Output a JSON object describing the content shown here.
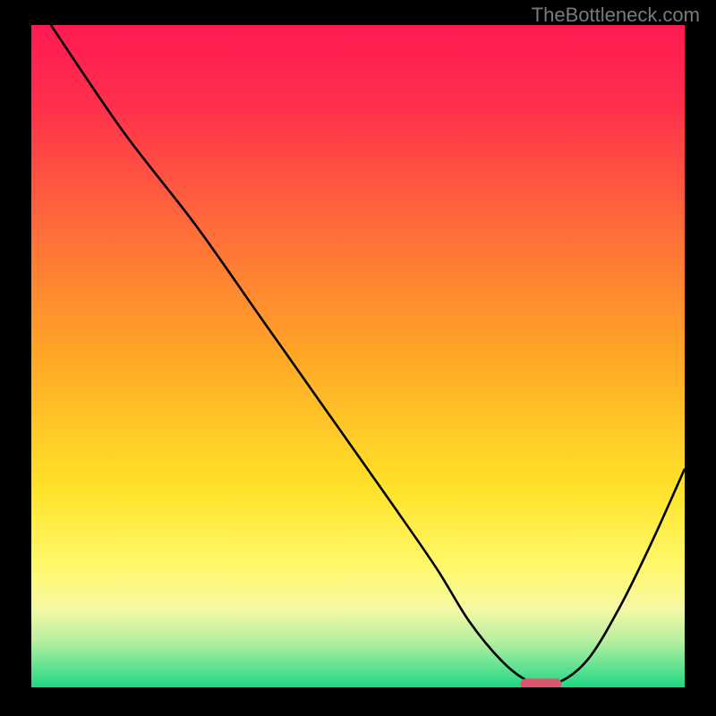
{
  "watermark": "TheBottleneck.com",
  "chart_data": {
    "type": "line",
    "title": "",
    "xlabel": "",
    "ylabel": "",
    "xlim": [
      0,
      100
    ],
    "ylim": [
      0,
      100
    ],
    "grid": false,
    "axes_visible": false,
    "background_gradient": {
      "stops": [
        {
          "offset": 0.0,
          "color": "#ff1a52"
        },
        {
          "offset": 0.12,
          "color": "#ff2f4c"
        },
        {
          "offset": 0.3,
          "color": "#ff6a3a"
        },
        {
          "offset": 0.5,
          "color": "#ffa726"
        },
        {
          "offset": 0.7,
          "color": "#ffe329"
        },
        {
          "offset": 0.82,
          "color": "#fff96d"
        },
        {
          "offset": 0.88,
          "color": "#f6f9a4"
        },
        {
          "offset": 0.93,
          "color": "#b7efa0"
        },
        {
          "offset": 0.97,
          "color": "#5fe391"
        },
        {
          "offset": 1.0,
          "color": "#1fd683"
        }
      ]
    },
    "series": [
      {
        "name": "bottleneck-curve",
        "x": [
          3,
          14,
          25,
          35,
          45,
          55,
          62,
          67,
          72,
          76,
          80,
          85,
          90,
          95,
          100
        ],
        "y": [
          100,
          84,
          70,
          56,
          42,
          28,
          18,
          10,
          4,
          1,
          0.5,
          4,
          12,
          22,
          33
        ]
      }
    ],
    "marker": {
      "name": "optimal-marker",
      "x": 78,
      "y": 0.5,
      "color": "#d9566b"
    }
  }
}
